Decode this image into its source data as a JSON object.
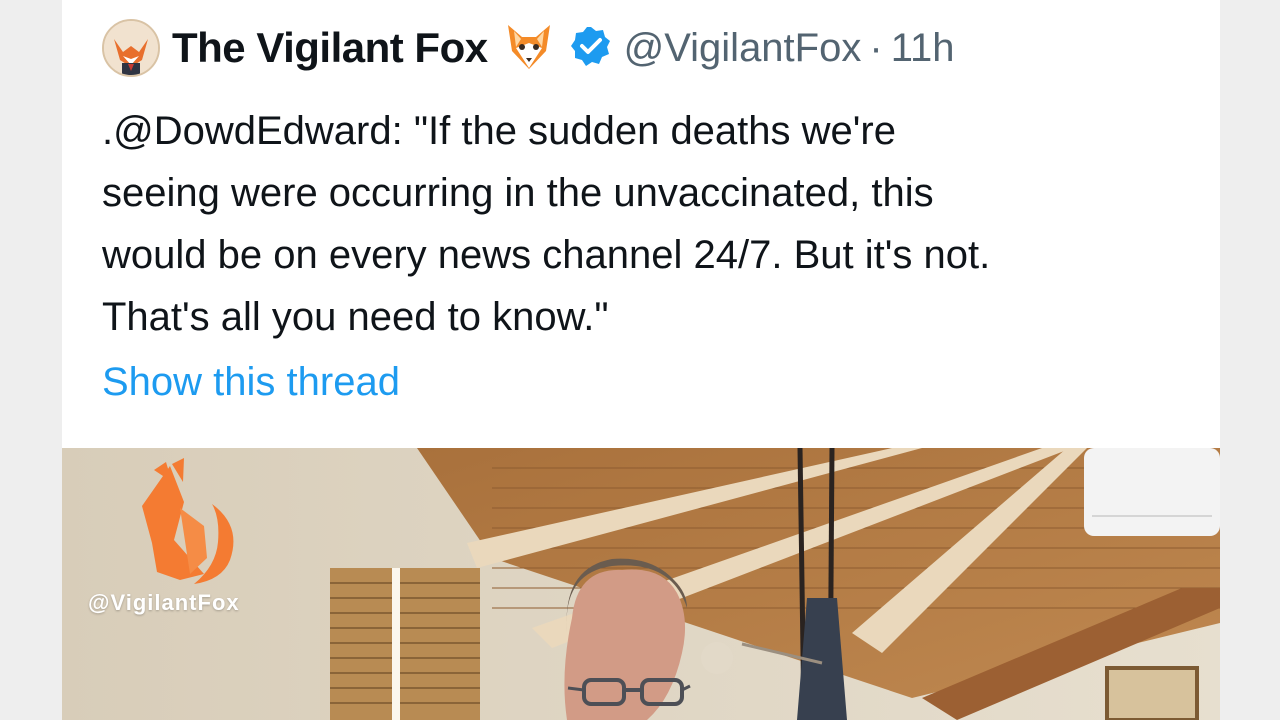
{
  "tweet": {
    "display_name": "The Vigilant Fox",
    "name_emoji": "fox-face-emoji",
    "verified": true,
    "handle": "@VigilantFox",
    "separator": "·",
    "time": "11h",
    "body_lines": [
      ".@DowdEdward: \"If the sudden deaths we're",
      "seeing were occurring in the unvaccinated, this",
      "would be on every news channel 24/7. But it's not.",
      "That's all you need to know.\""
    ],
    "show_thread": "Show this thread"
  },
  "media": {
    "watermark": "@VigilantFox",
    "logo": "fox-logo",
    "subject": "man-with-glasses"
  },
  "colors": {
    "text_primary": "#0f1419",
    "text_secondary": "#536471",
    "link": "#1d9bf0",
    "verified": "#1d9bf0",
    "watermark_orange": "#f47b32"
  }
}
